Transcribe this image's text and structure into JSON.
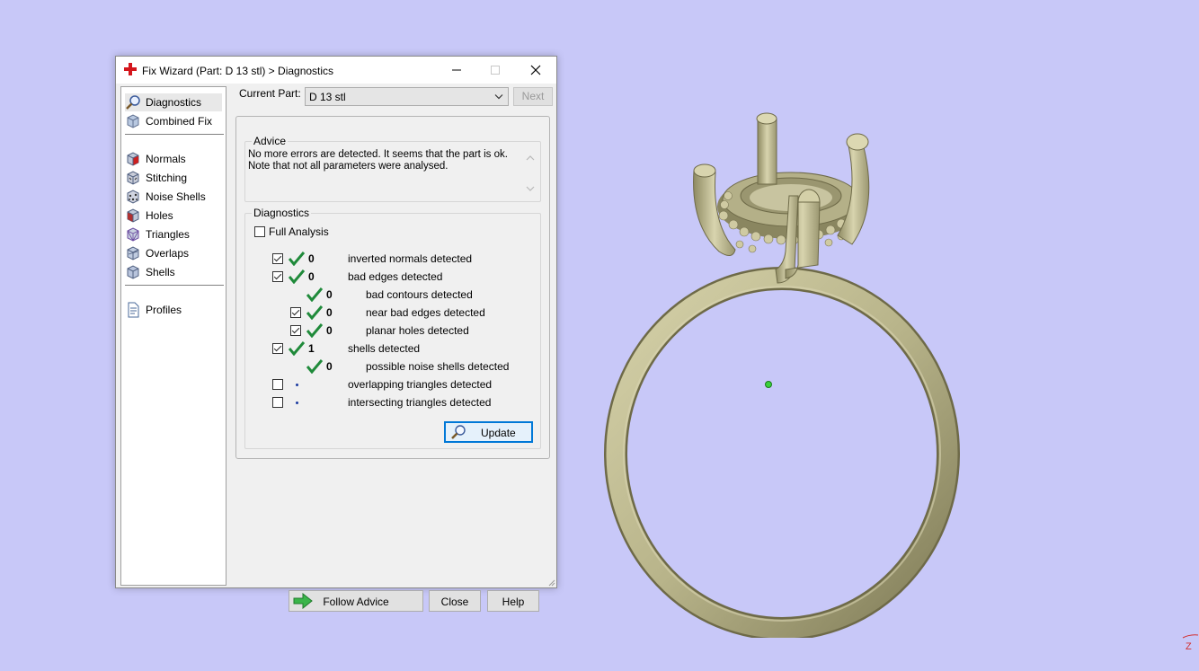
{
  "window": {
    "title": "Fix Wizard (Part: D 13 stl) > Diagnostics"
  },
  "sidebar": {
    "items": [
      {
        "label": "Diagnostics",
        "icon": "magnifier-icon"
      },
      {
        "label": "Combined Fix",
        "icon": "cube-icon"
      },
      {
        "label": "Normals",
        "icon": "normals-cube-icon"
      },
      {
        "label": "Stitching",
        "icon": "stitching-cube-icon"
      },
      {
        "label": "Noise Shells",
        "icon": "noise-shells-icon"
      },
      {
        "label": "Holes",
        "icon": "holes-cube-icon"
      },
      {
        "label": "Triangles",
        "icon": "triangles-icon"
      },
      {
        "label": "Overlaps",
        "icon": "overlaps-icon"
      },
      {
        "label": "Shells",
        "icon": "shells-icon"
      },
      {
        "label": "Profiles",
        "icon": "document-icon"
      }
    ]
  },
  "current_part": {
    "label": "Current Part:",
    "value": "D 13 stl",
    "next_label": "Next"
  },
  "advice": {
    "legend": "Advice",
    "text": "No more errors are detected. It seems that the part is ok.\nNote that not all parameters were analysed."
  },
  "diagnostics": {
    "legend": "Diagnostics",
    "full_analysis_label": "Full Analysis",
    "full_analysis_checked": false,
    "rows": [
      {
        "label": "inverted normals detected",
        "count": "0",
        "checked": true,
        "has_checkbox": true,
        "status": "ok"
      },
      {
        "label": "bad edges detected",
        "count": "0",
        "checked": true,
        "has_checkbox": true,
        "status": "ok"
      },
      {
        "label": "bad contours detected",
        "count": "0",
        "checked": false,
        "has_checkbox": false,
        "status": "ok"
      },
      {
        "label": "near bad edges detected",
        "count": "0",
        "checked": true,
        "has_checkbox": true,
        "status": "ok"
      },
      {
        "label": "planar holes detected",
        "count": "0",
        "checked": true,
        "has_checkbox": true,
        "status": "ok"
      },
      {
        "label": "shells detected",
        "count": "1",
        "checked": true,
        "has_checkbox": true,
        "status": "ok"
      },
      {
        "label": "possible noise shells detected",
        "count": "0",
        "checked": false,
        "has_checkbox": false,
        "status": "ok"
      },
      {
        "label": "overlapping triangles detected",
        "count": "",
        "checked": false,
        "has_checkbox": true,
        "status": "not-analysed"
      },
      {
        "label": "intersecting triangles detected",
        "count": "",
        "checked": false,
        "has_checkbox": true,
        "status": "not-analysed"
      }
    ],
    "update_label": "Update"
  },
  "buttons": {
    "follow_advice": "Follow Advice",
    "close": "Close",
    "help": "Help"
  },
  "viewport": {
    "axis_label": "Z",
    "ring_color": "#b8b48a",
    "background_color": "#c8c8f8"
  },
  "colors": {
    "ok_check": "#1f8a3a",
    "selection": "#0078d7"
  }
}
